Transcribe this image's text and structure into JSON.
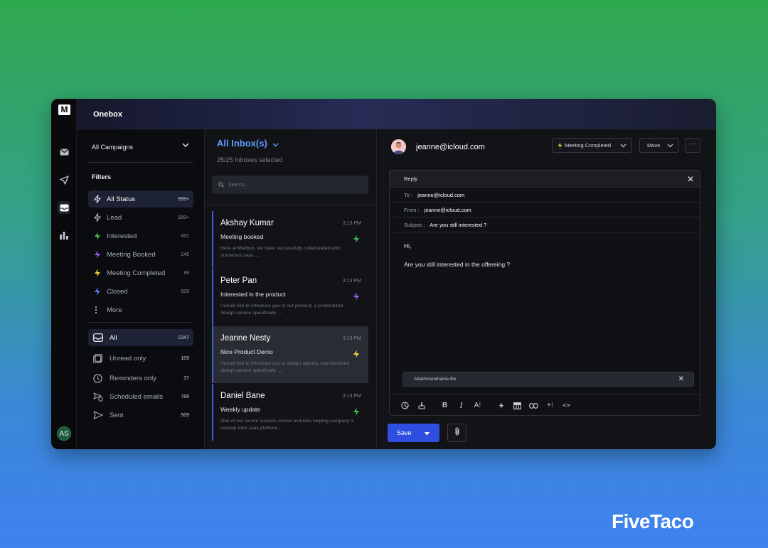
{
  "app": {
    "title": "Onebox",
    "user_initials": "AS",
    "logo": "M"
  },
  "campaign_selector": {
    "value": "All Campaigns"
  },
  "filters": {
    "label": "Filters",
    "items": [
      {
        "label": "All Status",
        "count": "999+",
        "icon": "bolt-icon",
        "color": "#ffffff"
      },
      {
        "label": "Lead",
        "count": "999+",
        "icon": "bolt-icon",
        "color": "#cfd2da"
      },
      {
        "label": "Interested",
        "count": "451",
        "icon": "bolt-icon",
        "color": "#3cc34a"
      },
      {
        "label": "Meeting Booked",
        "count": "245",
        "icon": "bolt-icon",
        "color": "#9b5cf6"
      },
      {
        "label": "Meeting Completed",
        "count": "99",
        "icon": "bolt-icon",
        "color": "#f1d23a"
      },
      {
        "label": "Closed",
        "count": "509",
        "icon": "bolt-icon",
        "color": "#5b7cf7"
      },
      {
        "label": "More",
        "count": "",
        "icon": "more-icon",
        "color": "#cfd2da"
      }
    ]
  },
  "mailboxes": [
    {
      "label": "All",
      "count": "2347",
      "icon": "inbox-icon"
    },
    {
      "label": "Unread only",
      "count": "109",
      "icon": "unread-icon"
    },
    {
      "label": "Reminders only",
      "count": "37",
      "icon": "clock-icon"
    },
    {
      "label": "Scheduled emails",
      "count": "789",
      "icon": "scheduled-icon"
    },
    {
      "label": "Sent",
      "count": "509",
      "icon": "send-icon"
    }
  ],
  "inbox": {
    "title": "All Inbox(s)",
    "subtitle": "25/25 Inboxes selected",
    "search_placeholder": "Search....",
    "mails": [
      {
        "name": "Akshay Kumar",
        "time": "3:13 PM",
        "subject": "Meeting booked",
        "preview": "Here at Mailbox, we have successfully collaborated with numerous saas ....",
        "bolt_color": "#3cc34a"
      },
      {
        "name": "Peter Pan",
        "time": "3:13 PM",
        "subject": "Interested in the product",
        "preview": "I would like to introduce you to our product, a productized design service specifically ....",
        "bolt_color": "#9b5cf6"
      },
      {
        "name": "Jeanne Nesty",
        "time": "3:13 PM",
        "subject": "Nice Product Demo",
        "preview": "I would like to introduce you to design agency, a productized design service specifically ....",
        "bolt_color": "#f1d23a"
      },
      {
        "name": "Daniel Bane",
        "time": "3:13 PM",
        "subject": "Weekly update",
        "preview": "One of our recent success stories includes helping company X revamp their saas platform....",
        "bolt_color": "#3cc34a"
      }
    ]
  },
  "detail": {
    "contact_email": "jeanne@icloud.com",
    "status_button": "Meeting Completed",
    "move_button": "Move",
    "more_button": "···",
    "reply": {
      "header": "Reply",
      "to_label": "To :",
      "to_value": "jeanne@icloud.com",
      "from_label": "From :",
      "from_value": "jeanne@icloud.com",
      "subject_label": "Subject :",
      "subject_value": "Are you still interested ?",
      "body_line1": "Hi,",
      "body_line2": "Are you still interested in the offereing ?",
      "attachment": "Attachmentname.file"
    },
    "save_label": "Save"
  },
  "brand": {
    "name": "FiveTaco"
  },
  "colors": {
    "accent": "#2f4fe0",
    "link": "#5e9bff"
  }
}
